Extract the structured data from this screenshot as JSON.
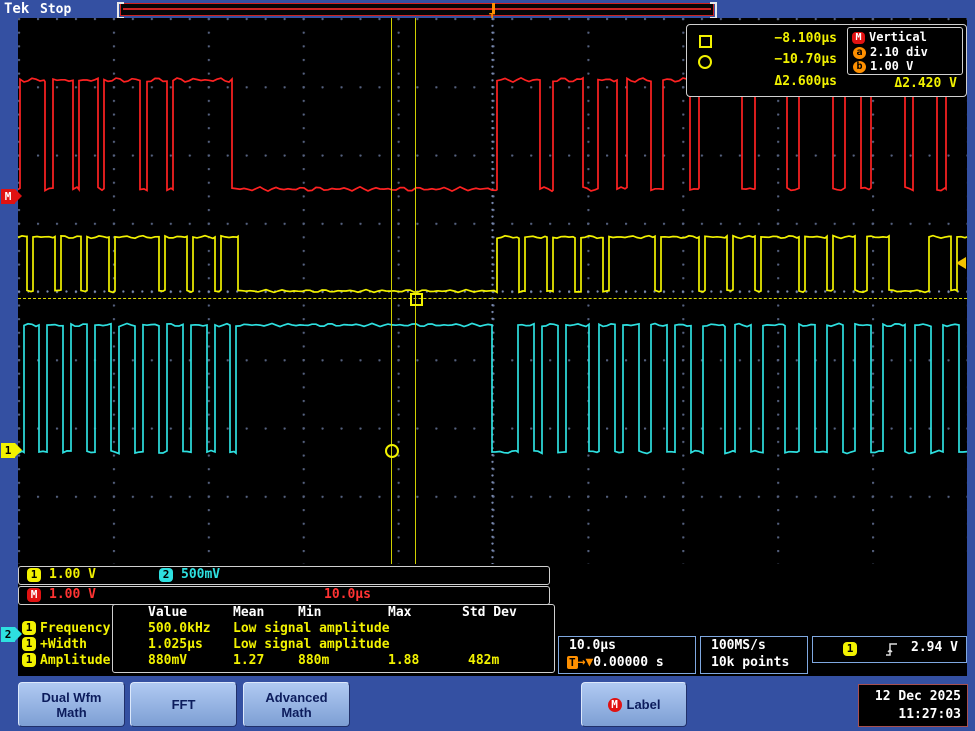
{
  "header": {
    "logo": "Tek",
    "status": "Stop"
  },
  "trigger_marker": {
    "label": "T"
  },
  "cursor_box": {
    "square_value": "−8.100µs",
    "circle_value": "−10.70µs",
    "delta_time": "Δ2.600µs",
    "vertical": {
      "source": "M",
      "title": "Vertical",
      "a_label": "a",
      "a_value": "2.10 div",
      "b_label": "b",
      "b_value": "1.00 V",
      "delta": "Δ2.420 V"
    }
  },
  "scale_bar_main": {
    "ch1_badge": "1",
    "ch1_scale": "1.00 V",
    "ch2_badge": "2",
    "ch2_scale": "500mV"
  },
  "scale_bar_math": {
    "badge": "M",
    "scale": "1.00 V",
    "time": "10.0µs"
  },
  "measure_source_badge": "2",
  "measurements": {
    "headers": [
      "Value",
      "Mean",
      "Min",
      "Max",
      "Std Dev"
    ],
    "rows": [
      {
        "badge": "1",
        "name": "Frequency",
        "value": "500.0kHz",
        "mean": "Low signal amplitude",
        "min": "",
        "max": "",
        "stddev": ""
      },
      {
        "badge": "1",
        "name": "+Width",
        "value": "1.025µs",
        "mean": "Low signal amplitude",
        "min": "",
        "max": "",
        "stddev": ""
      },
      {
        "badge": "1",
        "name": "Amplitude",
        "value": "880mV",
        "mean": "1.27",
        "min": "880m",
        "max": "1.88",
        "stddev": "482m"
      }
    ]
  },
  "horiz_box": {
    "scale": "10.0µs",
    "trig_prefix": "T",
    "trig_arrows": "→▼",
    "position": "0.00000 s"
  },
  "acq_box": {
    "rate": "100MS/s",
    "points": "10k points"
  },
  "trig_box": {
    "badge": "1",
    "level": "2.94 V"
  },
  "menu": {
    "math": "Dual Wfm\nMath",
    "fft": "FFT",
    "advanced": "Advanced\nMath",
    "label_badge": "M",
    "label": "Label"
  },
  "clock": {
    "date": "12 Dec 2025",
    "time": "11:27:03"
  },
  "waveforms": {
    "colors": {
      "math": "#ff2222",
      "ch1": "#f2f200",
      "ch2": "#2ee0e0",
      "trigger": "#ff9000"
    },
    "traces": [
      {
        "id": "math",
        "color": "#ff2222",
        "high": 80,
        "low": 189,
        "noise": 2.2,
        "segments": [
          [
            20,
            45
          ],
          [
            53,
            73
          ],
          [
            79,
            98
          ],
          [
            104,
            140
          ],
          [
            147,
            167
          ],
          [
            173,
            232
          ],
          [
            497,
            540
          ],
          [
            553,
            583
          ],
          [
            598,
            617
          ],
          [
            627,
            651
          ],
          [
            663,
            690
          ],
          [
            699,
            742
          ],
          [
            755,
            787
          ],
          [
            799,
            833
          ],
          [
            845,
            861
          ],
          [
            871,
            905
          ],
          [
            913,
            937
          ],
          [
            946,
            967
          ]
        ]
      },
      {
        "id": "ch1",
        "color": "#f2f200",
        "high": 237,
        "low": 291,
        "noise": 1.4,
        "segments": [
          [
            18,
            27
          ],
          [
            33,
            55
          ],
          [
            61,
            81
          ],
          [
            87,
            109
          ],
          [
            115,
            159
          ],
          [
            165,
            187
          ],
          [
            193,
            215
          ],
          [
            221,
            238
          ],
          [
            497,
            519
          ],
          [
            525,
            547
          ],
          [
            553,
            575
          ],
          [
            581,
            603
          ],
          [
            609,
            655
          ],
          [
            661,
            699
          ],
          [
            705,
            727
          ],
          [
            733,
            755
          ],
          [
            761,
            799
          ],
          [
            805,
            827
          ],
          [
            833,
            855
          ],
          [
            867,
            889
          ],
          [
            929,
            951
          ],
          [
            957,
            967
          ]
        ]
      },
      {
        "id": "ch2",
        "color": "#2ee0e0",
        "high": 325,
        "low": 452,
        "noise": 1.6,
        "segments": [
          [
            24,
            39
          ],
          [
            47,
            63
          ],
          [
            71,
            87
          ],
          [
            95,
            111
          ],
          [
            119,
            135
          ],
          [
            143,
            159
          ],
          [
            167,
            183
          ],
          [
            191,
            207
          ],
          [
            215,
            230
          ],
          [
            236,
            492
          ],
          [
            518,
            534
          ],
          [
            542,
            558
          ],
          [
            566,
            589
          ],
          [
            599,
            615
          ],
          [
            623,
            639
          ],
          [
            651,
            667
          ],
          [
            675,
            691
          ],
          [
            703,
            725
          ],
          [
            735,
            751
          ],
          [
            763,
            785
          ],
          [
            799,
            815
          ],
          [
            827,
            843
          ],
          [
            855,
            871
          ],
          [
            883,
            905
          ],
          [
            915,
            931
          ],
          [
            943,
            959
          ]
        ]
      }
    ]
  }
}
